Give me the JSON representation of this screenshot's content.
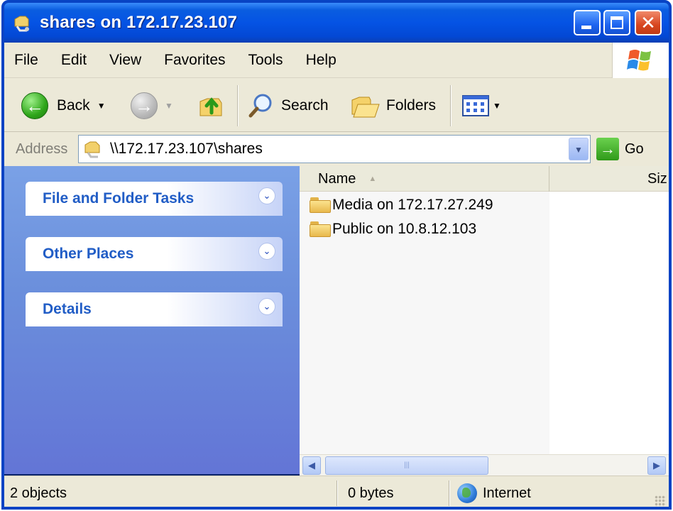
{
  "window": {
    "title": "shares on 172.17.23.107",
    "icons": [
      "network-share-icon",
      "minimize-icon",
      "maximize-icon",
      "close-icon"
    ]
  },
  "menubar": {
    "items": [
      {
        "label": "File",
        "accel": "F"
      },
      {
        "label": "Edit",
        "accel": "E"
      },
      {
        "label": "View",
        "accel": "V"
      },
      {
        "label": "Favorites",
        "accel": "a"
      },
      {
        "label": "Tools",
        "accel": "T"
      },
      {
        "label": "Help",
        "accel": "H"
      }
    ]
  },
  "toolbar": {
    "back_label": "Back",
    "search_label": "Search",
    "folders_label": "Folders",
    "icons": [
      "back-arrow-icon",
      "forward-arrow-icon",
      "up-folder-icon",
      "search-icon",
      "folders-icon",
      "views-icon"
    ]
  },
  "address": {
    "label": "Address",
    "value": "\\\\172.17.23.107\\shares",
    "go_label": "Go"
  },
  "taskpane": {
    "panels": [
      {
        "title": "File and Folder Tasks"
      },
      {
        "title": "Other Places"
      },
      {
        "title": "Details"
      }
    ]
  },
  "filelist": {
    "columns": {
      "name": "Name",
      "size": "Siz"
    },
    "items": [
      {
        "name": "Media on 172.17.27.249",
        "icon": "folder-icon"
      },
      {
        "name": "Public on 10.8.12.103",
        "icon": "folder-icon"
      }
    ]
  },
  "statusbar": {
    "objects": "2 objects",
    "size": "0 bytes",
    "zone": "Internet"
  },
  "colors": {
    "title_bar": "#0553e4",
    "chrome": "#ece9d8",
    "task_pane": "#6b8fdc",
    "task_title": "#215dc6"
  }
}
